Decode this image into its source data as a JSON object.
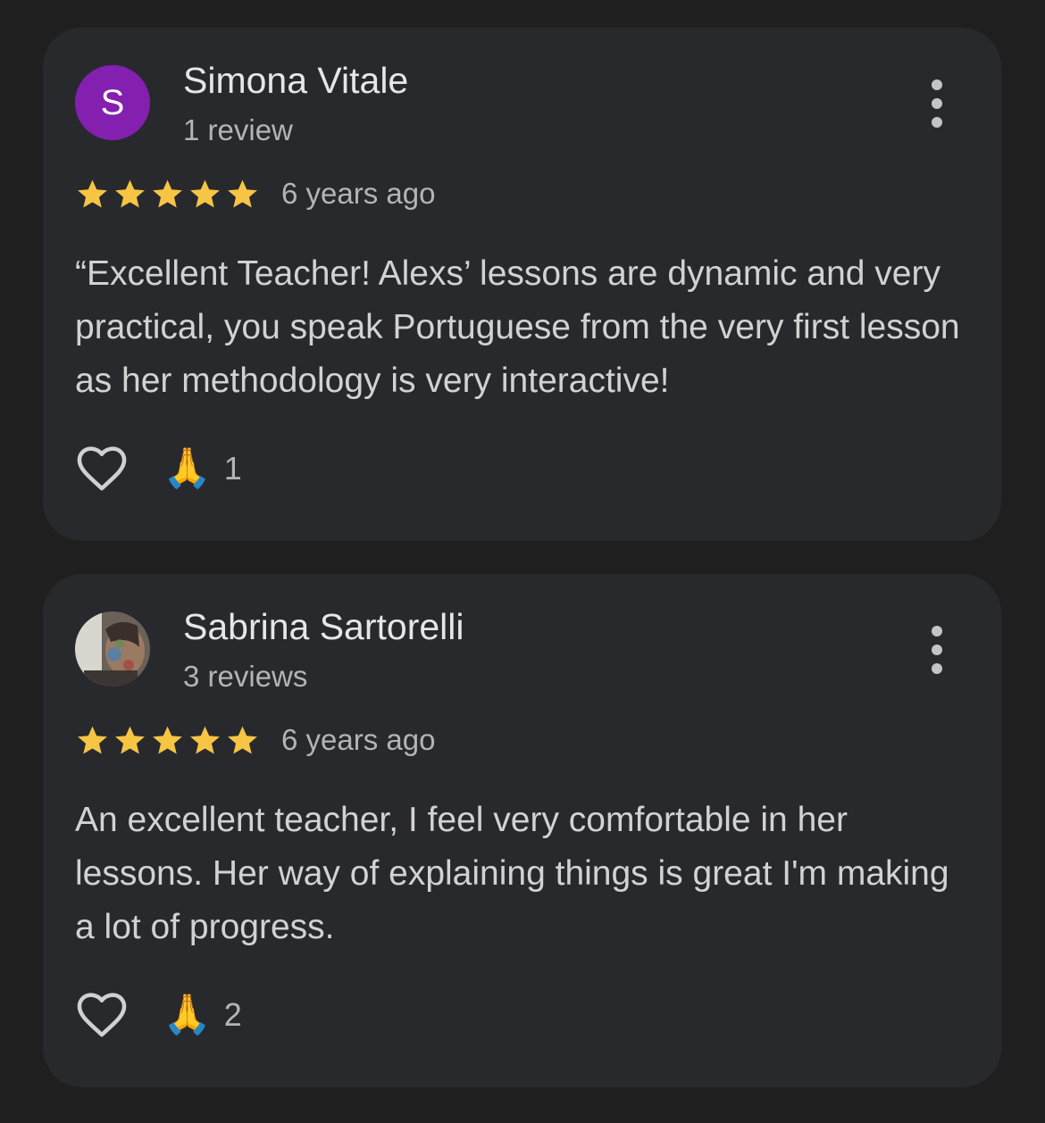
{
  "reviews": [
    {
      "name": "Simona Vitale",
      "avatar_letter": "S",
      "avatar_color": "#8420b0",
      "review_count": "1 review",
      "rating": 5,
      "time": "6 years ago",
      "text": "“Excellent Teacher! Alexs’ lessons are dynamic and very practical, you speak Portuguese from the very first lesson as her methodology is very interactive!",
      "reaction_emoji": "🙏",
      "reaction_count": "1"
    },
    {
      "name": "Sabrina Sartorelli",
      "avatar_letter": "",
      "review_count": "3 reviews",
      "rating": 5,
      "time": "6 years ago",
      "text": "An excellent teacher, I feel very comfortable in her lessons. Her way of explaining things is great I'm making a lot of progress.",
      "reaction_emoji": "🙏",
      "reaction_count": "2"
    }
  ],
  "colors": {
    "background": "#1f1f1f",
    "card": "#28292c",
    "star": "#f6c544",
    "text_primary": "#e6e6e6",
    "text_secondary": "#b4b4b8"
  },
  "icons": {
    "star": "star-icon",
    "like": "heart-outline-icon",
    "more": "more-vertical-icon"
  }
}
